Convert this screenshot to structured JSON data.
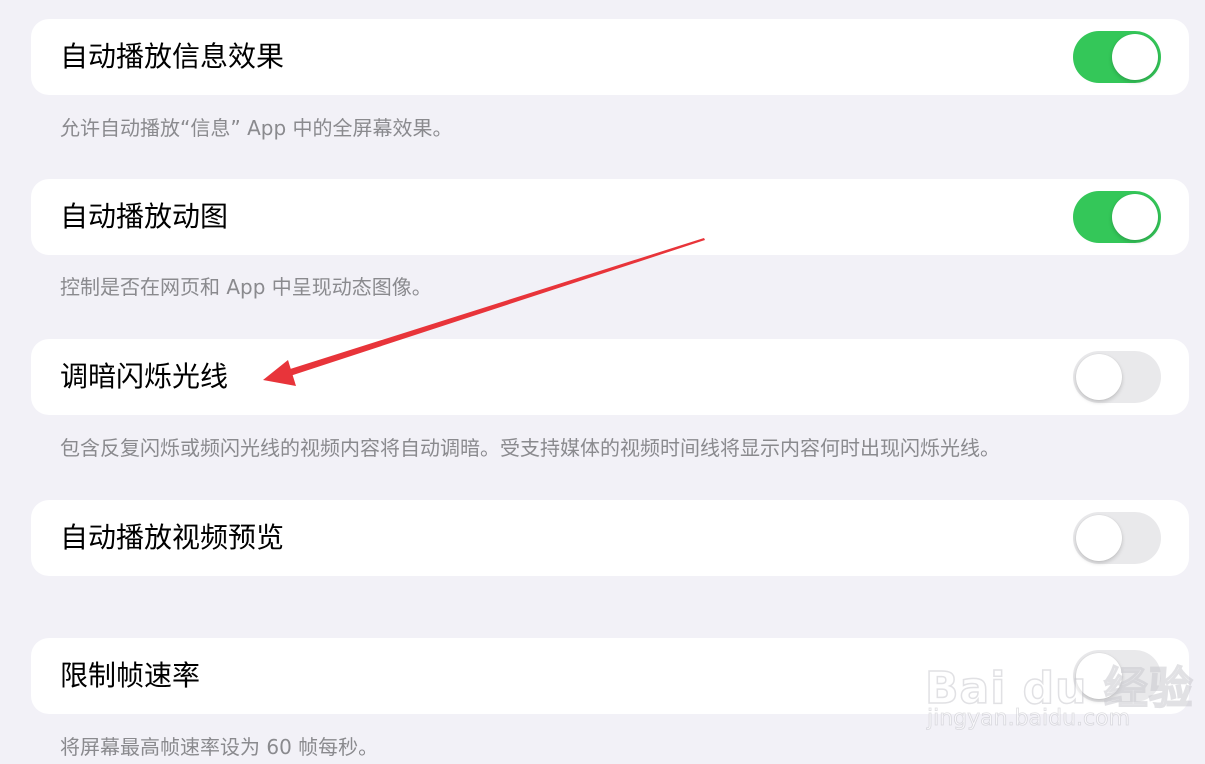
{
  "settings": [
    {
      "label": "自动播放信息效果",
      "enabled": true,
      "description": "允许自动播放“信息” App 中的全屏幕效果。"
    },
    {
      "label": "自动播放动图",
      "enabled": true,
      "description": "控制是否在网页和 App 中呈现动态图像。"
    },
    {
      "label": "调暗闪烁光线",
      "enabled": false,
      "description": "包含反复闪烁或频闪光线的视频内容将自动调暗。受支持媒体的视频时间线将显示内容何时出现闪烁光线。"
    },
    {
      "label": "自动播放视频预览",
      "enabled": false,
      "description": ""
    },
    {
      "label": "限制帧速率",
      "enabled": false,
      "description": "将屏幕最高帧速率设为 60 帧每秒。"
    }
  ],
  "colors": {
    "background": "#f2f1f7",
    "toggle_on": "#34c759",
    "toggle_off": "#e9e9eb",
    "annotation_arrow": "#e8343a"
  },
  "watermark": {
    "logo_text": "Bai du 经验",
    "url": "jingyan.baidu.com"
  }
}
